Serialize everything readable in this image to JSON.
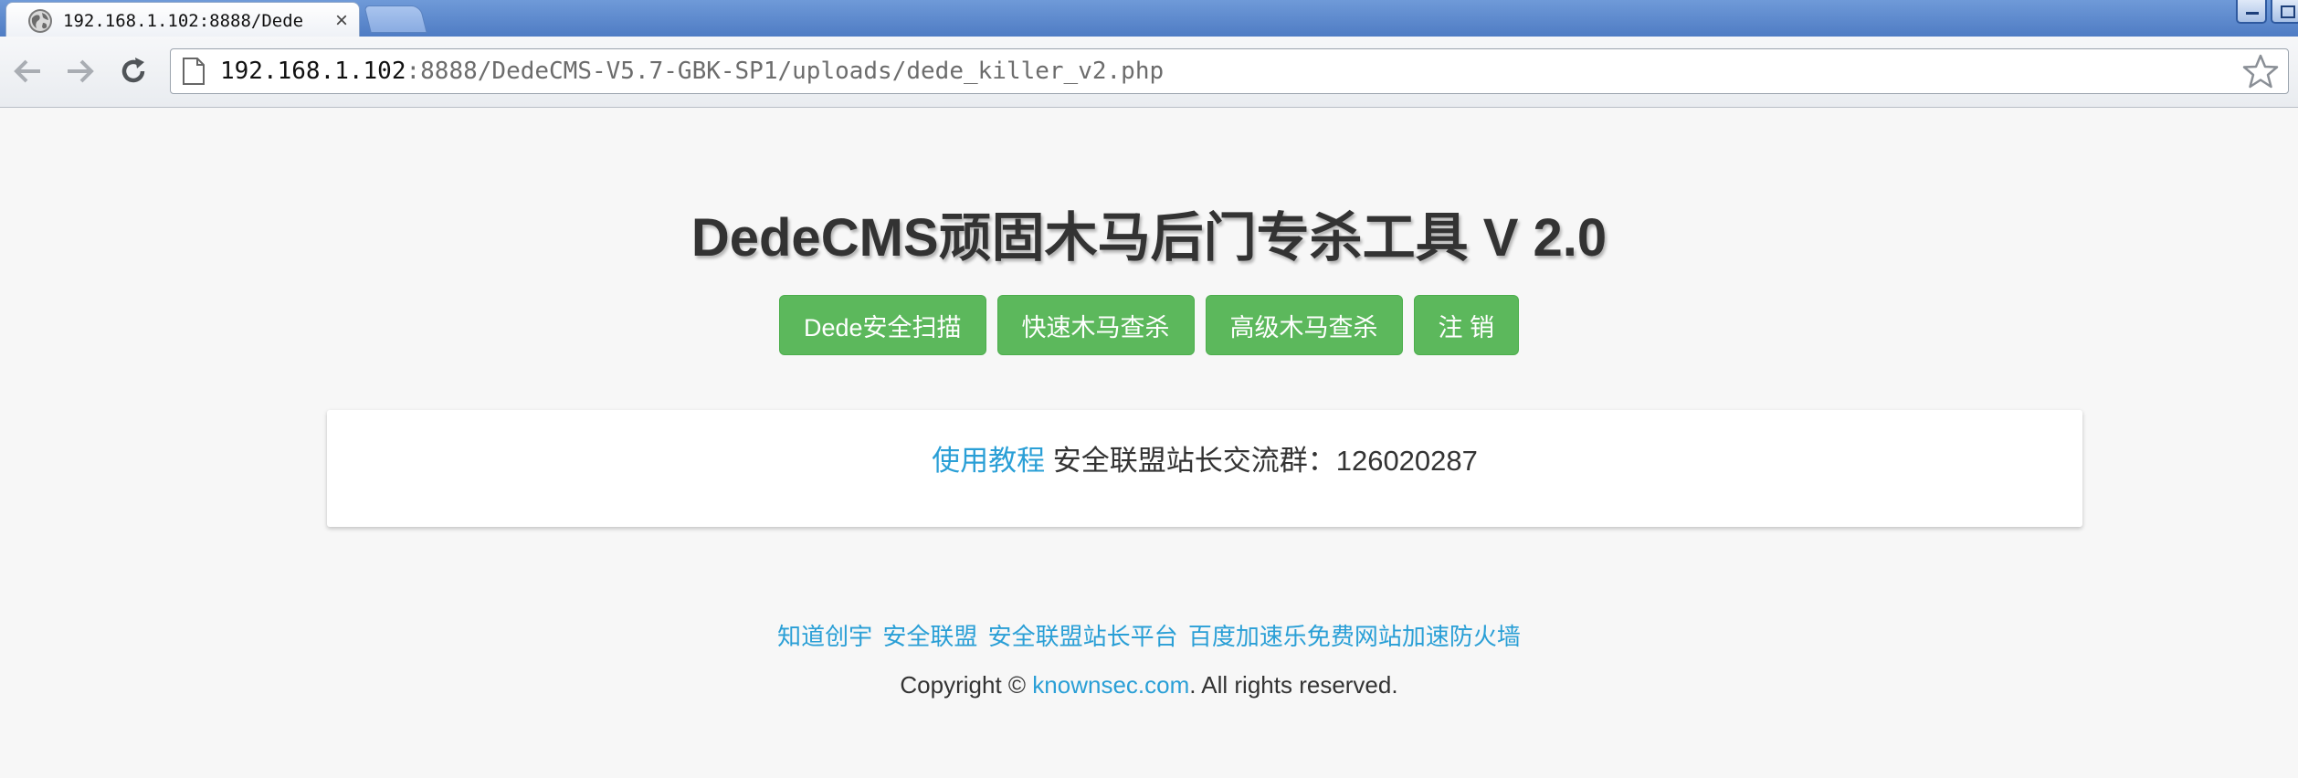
{
  "browser": {
    "tab_title": "192.168.1.102:8888/Dede",
    "tab_close": "×",
    "url_host": "192.168.1.102",
    "url_rest": ":8888/DedeCMS-V5.7-GBK-SP1/uploads/dede_killer_v2.php",
    "icons": [
      "globe-icon",
      "close-icon",
      "back-arrow-icon",
      "forward-arrow-icon",
      "reload-icon",
      "page-icon",
      "star-icon"
    ]
  },
  "header": {
    "title": "DedeCMS顽固木马后门专杀工具 V 2.0"
  },
  "buttons": [
    {
      "label": "Dede安全扫描"
    },
    {
      "label": "快速木马查杀"
    },
    {
      "label": "高级木马查杀"
    },
    {
      "label": "注 销"
    }
  ],
  "panel": {
    "tutorial_link": "使用教程",
    "group_text": " 安全联盟站长交流群：126020287"
  },
  "footer": {
    "links": [
      "知道创宇",
      "安全联盟",
      "安全联盟站长平台",
      "百度加速乐免费网站加速防火墙"
    ],
    "copyright_prefix": "Copyright © ",
    "copyright_link": "knownsec.com",
    "copyright_suffix": ". All rights reserved."
  },
  "colors": {
    "button_green": "#5cb85c",
    "link_blue": "#2a9fd6",
    "page_bg": "#f7f7f7",
    "chrome_blue": "#5b86cc"
  }
}
